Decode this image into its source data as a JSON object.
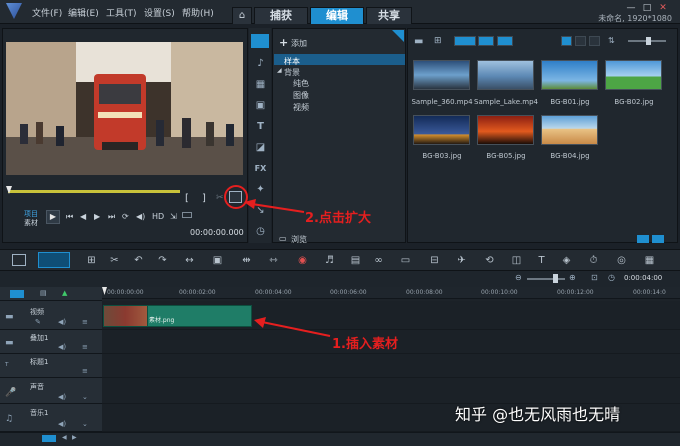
{
  "menu": [
    "文件(F)",
    "编辑(E)",
    "工具(T)",
    "设置(S)",
    "帮助(H)"
  ],
  "tabs": [
    {
      "label": "捕获"
    },
    {
      "label": "编辑"
    },
    {
      "label": "共享"
    }
  ],
  "window": {
    "minimize": "—",
    "maximize": "□",
    "close": "✕"
  },
  "project_info": "未命名, 1920*1080",
  "player": {
    "mode_project": "项目",
    "mode_clip": "素材",
    "hd": "HD",
    "timecode": "00:00:00.000",
    "bracket_in": "[",
    "bracket_out": "]"
  },
  "library": {
    "add_label": "添加",
    "tree": [
      "样本",
      "背景",
      "纯色",
      "图像",
      "视频"
    ],
    "browse_label": "浏览"
  },
  "thumbnails": [
    {
      "label": "Sample_360.mp4",
      "color": "#3a5f86"
    },
    {
      "label": "Sample_Lake.mp4",
      "color": "#6a8fb5"
    },
    {
      "label": "BG-B01.jpg",
      "color": "#3b8ed1"
    },
    {
      "label": "BG-B02.jpg",
      "color": "#4da545"
    },
    {
      "label": "BG-B03.jpg",
      "color": "#1d3a6e"
    },
    {
      "label": "BG-B05.jpg",
      "color": "#c4371e"
    },
    {
      "label": "BG-B04.jpg",
      "color": "#e1b36a"
    }
  ],
  "timeline": {
    "ruler": [
      "00:00:00:00",
      "00:00:02:00",
      "00:00:04:00",
      "00:00:06:00",
      "00:00:08:00",
      "00:00:10:00",
      "00:00:12:00",
      "00:00:14:0"
    ],
    "zoom_timecode": "0:00:04:00",
    "tracks": [
      {
        "name": "视频",
        "icon": "video-track-icon"
      },
      {
        "name": "叠加1",
        "icon": "overlay-track-icon"
      },
      {
        "name": "标题1",
        "icon": "title-track-icon"
      },
      {
        "name": "声音",
        "icon": "voice-track-icon"
      },
      {
        "name": "音乐1",
        "icon": "music-track-icon"
      }
    ],
    "clip_label": "素材.png"
  },
  "annotations": {
    "expand": "2.点击扩大",
    "insert": "1.插入素材"
  },
  "watermark": "知乎 @也无风雨也无晴",
  "colors": {
    "accent": "#1f8fd0",
    "annotation": "#e51f1f",
    "clip": "#1f7d67"
  }
}
